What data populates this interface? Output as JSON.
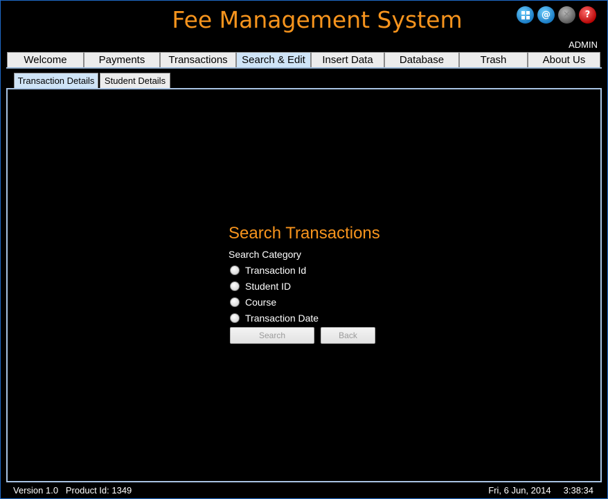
{
  "app": {
    "title": "Fee Management System",
    "user": "ADMIN"
  },
  "title_icons": [
    {
      "name": "dashboard-icon",
      "glyph": "grid"
    },
    {
      "name": "at-sign-icon",
      "glyph": "@"
    },
    {
      "name": "close-icon",
      "glyph": "✕"
    },
    {
      "name": "help-icon",
      "glyph": "?"
    }
  ],
  "main_tabs": [
    {
      "label": "Welcome",
      "active": false
    },
    {
      "label": "Payments",
      "active": false
    },
    {
      "label": "Transactions",
      "active": false
    },
    {
      "label": "Search & Edit",
      "active": true
    },
    {
      "label": "Insert Data",
      "active": false
    },
    {
      "label": "Database",
      "active": false
    },
    {
      "label": "Trash",
      "active": false
    },
    {
      "label": "About Us",
      "active": false
    }
  ],
  "sub_tabs": [
    {
      "label": "Transaction Details",
      "active": true
    },
    {
      "label": "Student Details",
      "active": false
    }
  ],
  "search": {
    "title": "Search Transactions",
    "category_label": "Search Category",
    "options": [
      "Transaction Id",
      "Student ID",
      "Course",
      "Transaction Date"
    ],
    "search_button": "Search",
    "back_button": "Back"
  },
  "status": {
    "version": "Version 1.0",
    "product_id": "Product Id: 1349",
    "date": "Fri, 6 Jun, 2014",
    "time": "3:38:34"
  },
  "colors": {
    "accent": "#f7941d",
    "background": "#000000",
    "active_tab": "#cfe4f7",
    "tab": "#ececec",
    "panel_border": "#a9c4e4"
  }
}
